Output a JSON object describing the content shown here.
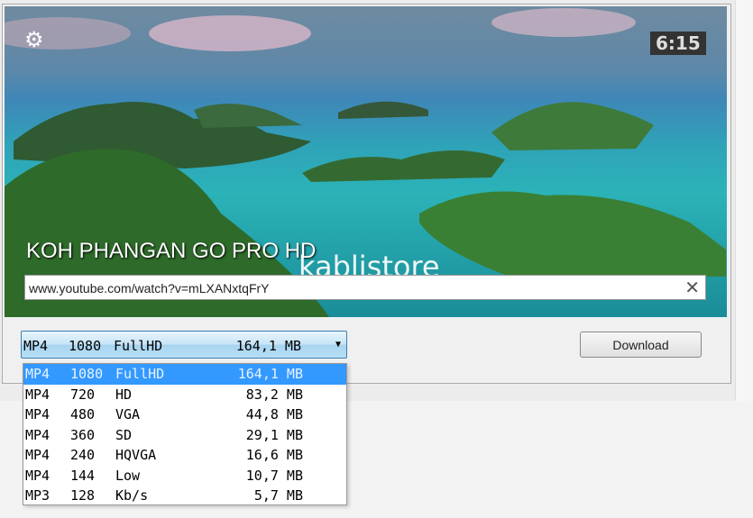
{
  "video": {
    "title": "KOH PHANGAN GO PRO HD",
    "duration": "6:15",
    "watermark": "kablistore"
  },
  "url": {
    "value": "www.youtube.com/watch?v=mLXANxtqFrY"
  },
  "format": {
    "selected": {
      "container": "MP4",
      "res": "1080",
      "quality": "FullHD",
      "size": "164,1 MB"
    },
    "options": [
      {
        "container": "MP4",
        "res": "1080",
        "quality": "FullHD",
        "size": "164,1 MB"
      },
      {
        "container": "MP4",
        "res": "720",
        "quality": "HD",
        "size": "83,2 MB"
      },
      {
        "container": "MP4",
        "res": "480",
        "quality": "VGA",
        "size": "44,8 MB"
      },
      {
        "container": "MP4",
        "res": "360",
        "quality": "SD",
        "size": "29,1 MB"
      },
      {
        "container": "MP4",
        "res": "240",
        "quality": "HQVGA",
        "size": "16,6 MB"
      },
      {
        "container": "MP4",
        "res": "144",
        "quality": "Low",
        "size": "10,7 MB"
      },
      {
        "container": "MP3",
        "res": "128",
        "quality": "Kb/s",
        "size": "5,7 MB"
      }
    ]
  },
  "download_label": "Download",
  "icons": {
    "settings": "gear-icon",
    "clear": "close-icon",
    "dropdown": "caret-down-icon"
  },
  "colors": {
    "selection": "#3399ff"
  }
}
